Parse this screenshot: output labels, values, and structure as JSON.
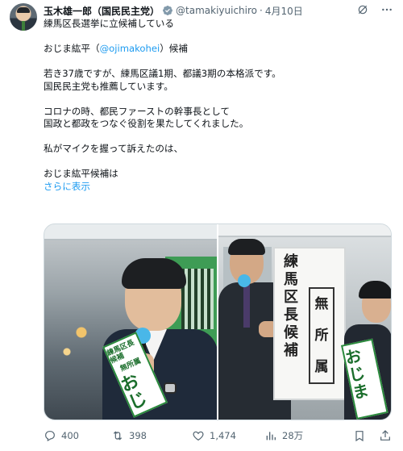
{
  "author": {
    "display_name": "玉木雄一郎（国民民主党）",
    "handle": "@tamakiyuichiro",
    "separator": "·",
    "date": "4月10日"
  },
  "tweet": {
    "line1": "練馬区長選挙に立候補している",
    "line2_pre": "おじま紘平（",
    "line2_mention": "@ojimakohei",
    "line2_post": "）候補",
    "line3": "若き37歳ですが、練馬区議1期、都議3期の本格派です。",
    "line4": "国民民主党も推薦しています。",
    "line5": "コロナの時、都民ファーストの幹事長として",
    "line6": "国政と都政をつなぐ役割を果たしてくれました。",
    "line7": "私がマイクを握って訴えたのは、",
    "line8": "おじま紘平候補は",
    "show_more": "さらに表示"
  },
  "photo1": {
    "sash_small": "練馬区長候補",
    "sash_small2": "無所属",
    "sash_big": "おじ"
  },
  "photo2": {
    "sign_col1": [
      "練",
      "馬",
      "区",
      "長",
      "候",
      "補"
    ],
    "sign_col2": [
      "無",
      "所",
      "属"
    ],
    "sash_big": "おじま"
  },
  "actions": {
    "reply_count": "400",
    "retweet_count": "398",
    "like_count": "1,474",
    "views_count": "28万"
  },
  "colors": {
    "accent": "#1d9bf0",
    "muted": "#536471",
    "verified": "#829aab"
  }
}
